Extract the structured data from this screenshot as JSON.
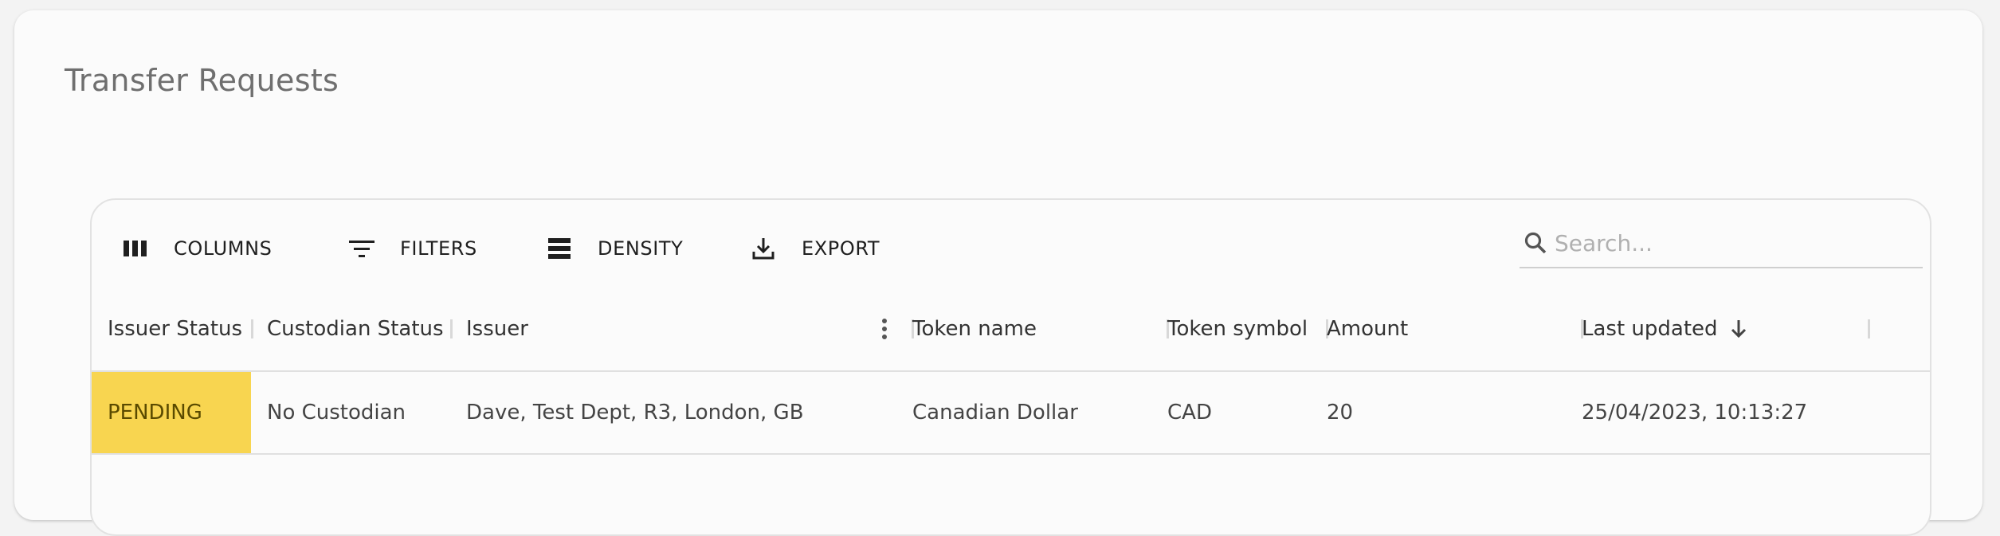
{
  "page": {
    "title": "Transfer Requests"
  },
  "toolbar": {
    "columns_label": "COLUMNS",
    "filters_label": "FILTERS",
    "density_label": "DENSITY",
    "export_label": "EXPORT",
    "search_placeholder": "Search..."
  },
  "table": {
    "headers": {
      "issuer_status": "Issuer Status",
      "custodian_status": "Custodian Status",
      "issuer": "Issuer",
      "token_name": "Token name",
      "token_symbol": "Token symbol",
      "amount": "Amount",
      "last_updated": "Last updated"
    },
    "sort": {
      "column": "last_updated",
      "direction": "descending",
      "icon": "arrow-down-icon"
    },
    "rows": [
      {
        "issuer_status": "PENDING",
        "custodian_status": "No Custodian",
        "issuer": "Dave, Test Dept, R3, London, GB",
        "token_name": "Canadian Dollar",
        "token_symbol": "CAD",
        "amount": "20",
        "last_updated": "25/04/2023, 10:13:27"
      }
    ]
  },
  "icons": {
    "columns": "view-column-icon",
    "filters": "filter-list-icon",
    "density": "density-icon",
    "export": "download-icon",
    "search": "search-icon",
    "column_menu": "more-vertical-icon"
  },
  "colors": {
    "pending_status": "#f8d550",
    "title_text": "#6f6f6f",
    "border": "#e0e0e0"
  }
}
